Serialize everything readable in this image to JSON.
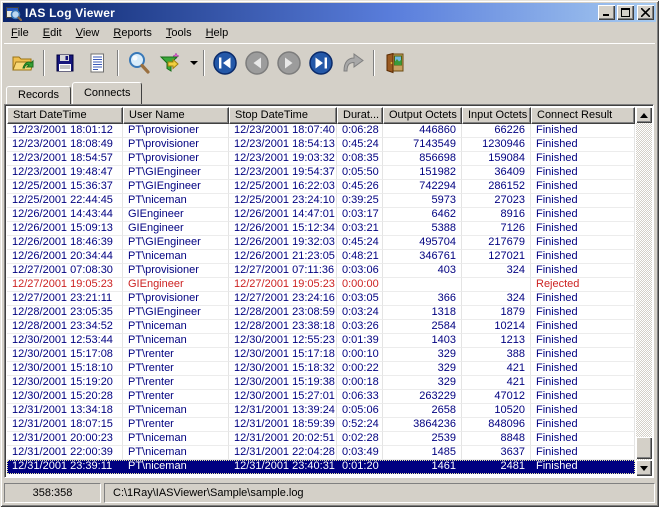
{
  "window": {
    "title": "IAS Log Viewer"
  },
  "menu": {
    "items": [
      "File",
      "Edit",
      "View",
      "Reports",
      "Tools",
      "Help"
    ]
  },
  "toolbar": {
    "buttons": [
      {
        "name": "open-log-button",
        "icon": "open-folder-icon"
      },
      {
        "name": "save-button",
        "icon": "floppy-disk-icon"
      },
      {
        "name": "report-button",
        "icon": "report-document-icon"
      },
      {
        "name": "find-button",
        "icon": "search-icon"
      },
      {
        "name": "filter-button",
        "icon": "filter-funnel-icon"
      },
      {
        "name": "first-record-button",
        "icon": "first-record-icon"
      },
      {
        "name": "previous-record-button",
        "icon": "previous-record-icon"
      },
      {
        "name": "next-record-button",
        "icon": "next-record-icon"
      },
      {
        "name": "last-record-button",
        "icon": "last-record-icon"
      },
      {
        "name": "goto-record-button",
        "icon": "goto-arrow-icon"
      },
      {
        "name": "exit-button",
        "icon": "exit-door-icon"
      }
    ]
  },
  "tabs": [
    {
      "label": "Records",
      "active": false
    },
    {
      "label": "Connects",
      "active": true
    }
  ],
  "table": {
    "columns": [
      "Start DateTime",
      "User Name",
      "Stop DateTime",
      "Durat...",
      "Output Octets",
      "Input Octets",
      "Connect Result"
    ],
    "rows": [
      {
        "state": "normal",
        "cells": [
          "12/23/2001 18:01:12",
          "PT\\provisioner",
          "12/23/2001 18:07:40",
          "0:06:28",
          "446860",
          "66226",
          "Finished"
        ]
      },
      {
        "state": "normal",
        "cells": [
          "12/23/2001 18:08:49",
          "PT\\provisioner",
          "12/23/2001 18:54:13",
          "0:45:24",
          "7143549",
          "1230946",
          "Finished"
        ]
      },
      {
        "state": "normal",
        "cells": [
          "12/23/2001 18:54:57",
          "PT\\provisioner",
          "12/23/2001 19:03:32",
          "0:08:35",
          "856698",
          "159084",
          "Finished"
        ]
      },
      {
        "state": "normal",
        "cells": [
          "12/23/2001 19:48:47",
          "PT\\GIEngineer",
          "12/23/2001 19:54:37",
          "0:05:50",
          "151982",
          "36409",
          "Finished"
        ]
      },
      {
        "state": "normal",
        "cells": [
          "12/25/2001 15:36:37",
          "PT\\GIEngineer",
          "12/25/2001 16:22:03",
          "0:45:26",
          "742294",
          "286152",
          "Finished"
        ]
      },
      {
        "state": "normal",
        "cells": [
          "12/25/2001 22:44:45",
          "PT\\niceman",
          "12/25/2001 23:24:10",
          "0:39:25",
          "5973",
          "27023",
          "Finished"
        ]
      },
      {
        "state": "normal",
        "cells": [
          "12/26/2001 14:43:44",
          "GIEngineer",
          "12/26/2001 14:47:01",
          "0:03:17",
          "6462",
          "8916",
          "Finished"
        ]
      },
      {
        "state": "normal",
        "cells": [
          "12/26/2001 15:09:13",
          "GIEngineer",
          "12/26/2001 15:12:34",
          "0:03:21",
          "5388",
          "7126",
          "Finished"
        ]
      },
      {
        "state": "normal",
        "cells": [
          "12/26/2001 18:46:39",
          "PT\\GIEngineer",
          "12/26/2001 19:32:03",
          "0:45:24",
          "495704",
          "217679",
          "Finished"
        ]
      },
      {
        "state": "normal",
        "cells": [
          "12/26/2001 20:34:44",
          "PT\\niceman",
          "12/26/2001 21:23:05",
          "0:48:21",
          "346761",
          "127021",
          "Finished"
        ]
      },
      {
        "state": "normal",
        "cells": [
          "12/27/2001 07:08:30",
          "PT\\provisioner",
          "12/27/2001 07:11:36",
          "0:03:06",
          "403",
          "324",
          "Finished"
        ]
      },
      {
        "state": "rejected",
        "cells": [
          "12/27/2001 19:05:23",
          "GIEngineer",
          "12/27/2001 19:05:23",
          "0:00:00",
          "",
          "",
          "Rejected"
        ]
      },
      {
        "state": "normal",
        "cells": [
          "12/27/2001 23:21:11",
          "PT\\provisioner",
          "12/27/2001 23:24:16",
          "0:03:05",
          "366",
          "324",
          "Finished"
        ]
      },
      {
        "state": "normal",
        "cells": [
          "12/28/2001 23:05:35",
          "PT\\GIEngineer",
          "12/28/2001 23:08:59",
          "0:03:24",
          "1318",
          "1879",
          "Finished"
        ]
      },
      {
        "state": "normal",
        "cells": [
          "12/28/2001 23:34:52",
          "PT\\niceman",
          "12/28/2001 23:38:18",
          "0:03:26",
          "2584",
          "10214",
          "Finished"
        ]
      },
      {
        "state": "normal",
        "cells": [
          "12/30/2001 12:53:44",
          "PT\\niceman",
          "12/30/2001 12:55:23",
          "0:01:39",
          "1403",
          "1213",
          "Finished"
        ]
      },
      {
        "state": "normal",
        "cells": [
          "12/30/2001 15:17:08",
          "PT\\renter",
          "12/30/2001 15:17:18",
          "0:00:10",
          "329",
          "388",
          "Finished"
        ]
      },
      {
        "state": "normal",
        "cells": [
          "12/30/2001 15:18:10",
          "PT\\renter",
          "12/30/2001 15:18:32",
          "0:00:22",
          "329",
          "421",
          "Finished"
        ]
      },
      {
        "state": "normal",
        "cells": [
          "12/30/2001 15:19:20",
          "PT\\renter",
          "12/30/2001 15:19:38",
          "0:00:18",
          "329",
          "421",
          "Finished"
        ]
      },
      {
        "state": "normal",
        "cells": [
          "12/30/2001 15:20:28",
          "PT\\renter",
          "12/30/2001 15:27:01",
          "0:06:33",
          "263229",
          "47012",
          "Finished"
        ]
      },
      {
        "state": "normal",
        "cells": [
          "12/31/2001 13:34:18",
          "PT\\niceman",
          "12/31/2001 13:39:24",
          "0:05:06",
          "2658",
          "10520",
          "Finished"
        ]
      },
      {
        "state": "normal",
        "cells": [
          "12/31/2001 18:07:15",
          "PT\\renter",
          "12/31/2001 18:59:39",
          "0:52:24",
          "3864236",
          "848096",
          "Finished"
        ]
      },
      {
        "state": "normal",
        "cells": [
          "12/31/2001 20:00:23",
          "PT\\niceman",
          "12/31/2001 20:02:51",
          "0:02:28",
          "2539",
          "8848",
          "Finished"
        ]
      },
      {
        "state": "normal",
        "cells": [
          "12/31/2001 22:00:39",
          "PT\\niceman",
          "12/31/2001 22:04:28",
          "0:03:49",
          "1485",
          "3637",
          "Finished"
        ]
      },
      {
        "state": "selected",
        "cells": [
          "12/31/2001 23:39:11",
          "PT\\niceman",
          "12/31/2001 23:40:31",
          "0:01:20",
          "1461",
          "2481",
          "Finished"
        ]
      }
    ]
  },
  "statusbar": {
    "record_count": "358:358",
    "file_path": "C:\\1Ray\\IASViewer\\Sample\\sample.log"
  },
  "colors": {
    "chrome": "#d4d0c8",
    "titlebar_start": "#0a246a",
    "titlebar_end": "#a6caf0",
    "row_text": "#000080",
    "rejected_text": "#cc2222",
    "selected_bg": "#000080",
    "selected_text": "#ffffff"
  }
}
